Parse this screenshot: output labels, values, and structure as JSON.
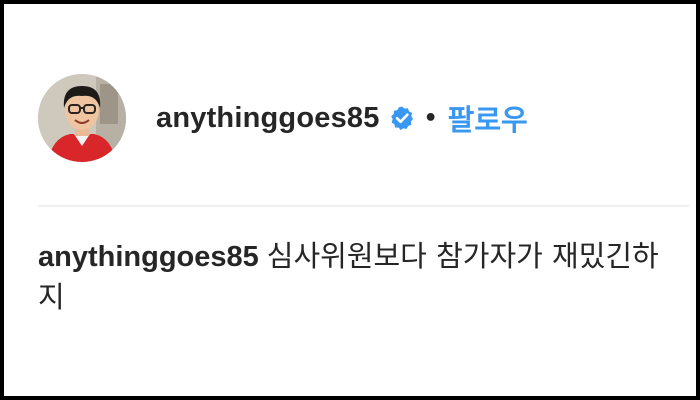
{
  "post": {
    "username": "anythinggoes85",
    "verified_icon": "verified-badge-icon",
    "separator": "•",
    "follow_label": "팔로우",
    "accent_color": "#3897f0"
  },
  "comment": {
    "username": "anythinggoes85",
    "text": "심사위원보다 참가자가 재밌긴하지"
  }
}
